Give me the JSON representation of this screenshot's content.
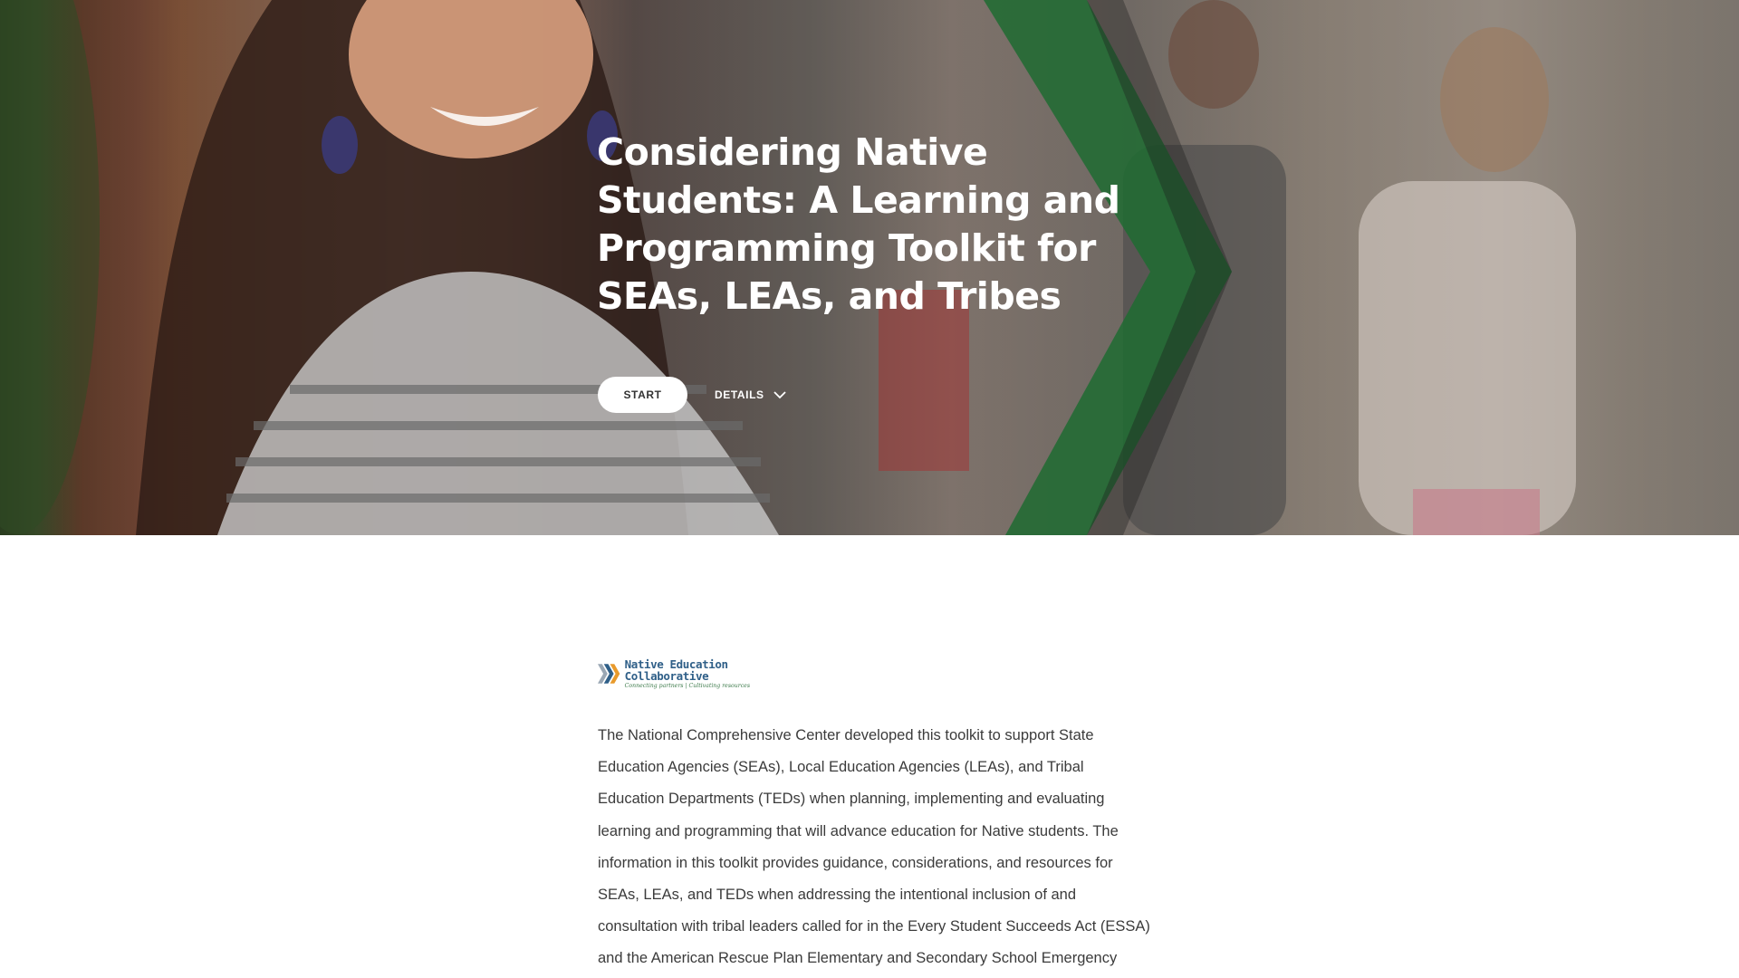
{
  "hero": {
    "title": "Considering Native Students: A Learning and Programming Toolkit for SEAs, LEAs, and Tribes",
    "start_label": "START",
    "details_label": "DETAILS",
    "details_icon": "chevron-down-icon"
  },
  "logo": {
    "line1": "Native Education",
    "line2": "Collaborative",
    "tagline": "Connecting partners | Cultivating resources",
    "colors": {
      "blue": "#2f5f88",
      "orange": "#e89a2c",
      "green": "#3c7a4a",
      "gray": "#9aa7b4"
    }
  },
  "intro": {
    "text": "The National Comprehensive Center developed this toolkit to support State Education Agencies (SEAs), Local Education Agencies (LEAs), and Tribal Education Departments (TEDs) when planning, implementing and evaluating learning and programming that will advance education for Native students. The information in this toolkit provides guidance, considerations, and resources for SEAs, LEAs, and TEDs when addressing the intentional inclusion of and consultation with tribal leaders called for in the Every Student Succeeds Act (ESSA) and the American Rescue Plan Elementary and Secondary School Emergency Relief Fund (ARP"
  },
  "colors": {
    "accent_green": "#2e8b3a",
    "text": "#3b3b3b",
    "white": "#ffffff"
  }
}
